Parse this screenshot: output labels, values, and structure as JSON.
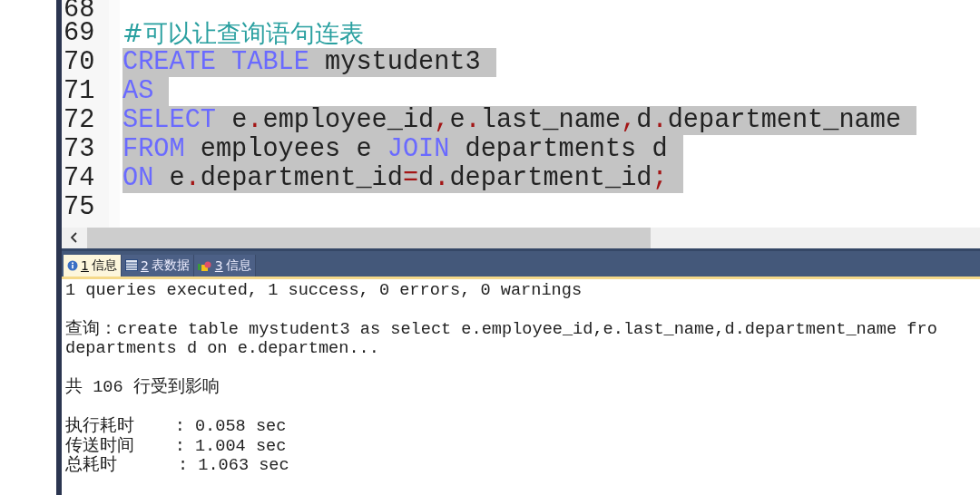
{
  "editor": {
    "lines": [
      {
        "number": "68",
        "selected": false
      },
      {
        "number": "69",
        "selected": false,
        "tokens": [
          {
            "kind": "comment",
            "text": "#可以让查询语句连表"
          }
        ]
      },
      {
        "number": "70",
        "selected": true,
        "tokens": [
          {
            "kind": "keyword",
            "text": "CREATE TABLE"
          },
          {
            "kind": "plain",
            "text": " mystudent3"
          }
        ]
      },
      {
        "number": "71",
        "selected": true,
        "tokens": [
          {
            "kind": "keyword",
            "text": "AS"
          }
        ]
      },
      {
        "number": "72",
        "selected": true,
        "tokens": [
          {
            "kind": "keyword",
            "text": "SELECT"
          },
          {
            "kind": "plain",
            "text": " e"
          },
          {
            "kind": "operator",
            "text": "."
          },
          {
            "kind": "plain",
            "text": "employee_id"
          },
          {
            "kind": "operator",
            "text": ","
          },
          {
            "kind": "plain",
            "text": "e"
          },
          {
            "kind": "operator",
            "text": "."
          },
          {
            "kind": "plain",
            "text": "last_name"
          },
          {
            "kind": "operator",
            "text": ","
          },
          {
            "kind": "plain",
            "text": "d"
          },
          {
            "kind": "operator",
            "text": "."
          },
          {
            "kind": "plain",
            "text": "department_name"
          }
        ]
      },
      {
        "number": "73",
        "selected": true,
        "tokens": [
          {
            "kind": "keyword",
            "text": "FROM"
          },
          {
            "kind": "plain",
            "text": " employees e "
          },
          {
            "kind": "keyword",
            "text": "JOIN"
          },
          {
            "kind": "plain",
            "text": " departments d"
          }
        ]
      },
      {
        "number": "74",
        "selected": true,
        "tokens": [
          {
            "kind": "keyword",
            "text": "ON"
          },
          {
            "kind": "plain",
            "text": " e"
          },
          {
            "kind": "operator",
            "text": "."
          },
          {
            "kind": "plain",
            "text": "department_id"
          },
          {
            "kind": "operator",
            "text": "="
          },
          {
            "kind": "plain",
            "text": "d"
          },
          {
            "kind": "operator",
            "text": "."
          },
          {
            "kind": "plain",
            "text": "department_id"
          },
          {
            "kind": "operator",
            "text": ";"
          }
        ]
      },
      {
        "number": "75",
        "selected": false
      }
    ]
  },
  "result_tabs": [
    {
      "key": "1",
      "label": "信息",
      "kind": "info",
      "selected": true
    },
    {
      "key": "2",
      "label": "表数据",
      "kind": "table",
      "selected": false
    },
    {
      "key": "3",
      "label": "信息",
      "kind": "blocks",
      "selected": false
    }
  ],
  "output": {
    "blocks": [
      [
        "1 queries executed, 1 success, 0 errors, 0 warnings"
      ],
      [
        "查询：create table mystudent3 as select e.employee_id,e.last_name,d.department_name fro",
        "departments d on e.departmen..."
      ],
      [
        "共 106 行受到影响"
      ],
      [
        "执行耗时    : 0.058 sec",
        "传送时间    : 1.004 sec",
        "总耗时      : 1.063 sec"
      ]
    ]
  }
}
